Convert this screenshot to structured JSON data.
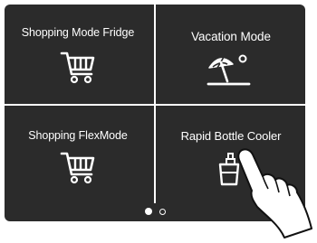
{
  "tiles": [
    {
      "label": "Shopping Mode Fridge",
      "icon": "shopping-cart-icon"
    },
    {
      "label": "Vacation Mode",
      "icon": "beach-umbrella-sun-icon"
    },
    {
      "label": "Shopping FlexMode",
      "icon": "shopping-cart-icon"
    },
    {
      "label": "Rapid Bottle Cooler",
      "icon": "bottle-ice-bucket-icon"
    }
  ],
  "pagination": {
    "pages": 2,
    "current": 1
  },
  "colors": {
    "panel": "#2b2b2b",
    "foreground": "#ffffff"
  }
}
